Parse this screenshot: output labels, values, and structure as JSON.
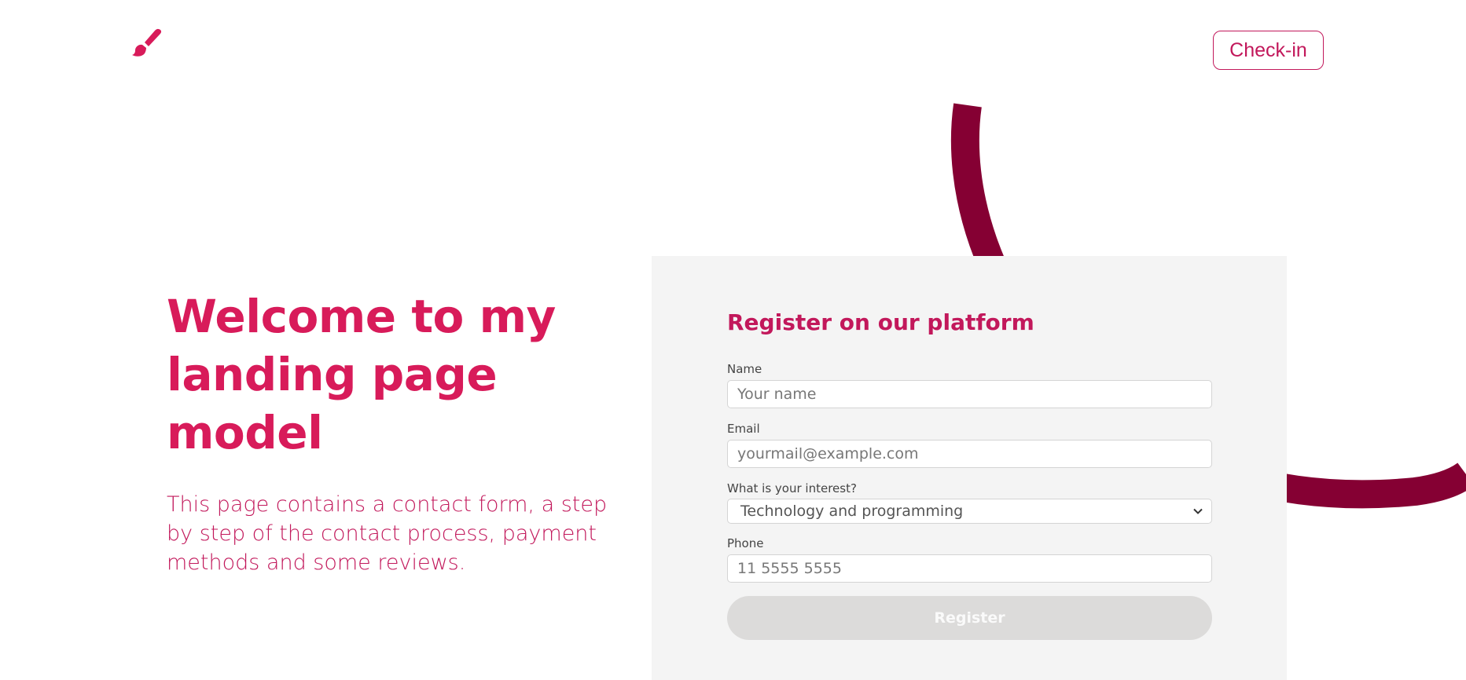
{
  "header": {
    "logo_icon": "paintbrush-icon",
    "checkin_label": "Check-in"
  },
  "hero": {
    "title": "Welcome to my landing page model",
    "description": "This page contains a contact form, a step by step of the contact process, payment methods and some reviews."
  },
  "form": {
    "title": "Register on our platform",
    "name": {
      "label": "Name",
      "placeholder": "Your name"
    },
    "email": {
      "label": "Email",
      "placeholder": "yourmail@example.com"
    },
    "interest": {
      "label": "What is your interest?",
      "selected": "Technology and programming"
    },
    "phone": {
      "label": "Phone",
      "placeholder": "11 5555 5555"
    },
    "submit_label": "Register"
  },
  "colors": {
    "brand": "#d81b5a",
    "brand_dark": "#c2185b",
    "arc": "#850033",
    "panel_bg": "#f4f4f4",
    "button_disabled": "#dcdbda"
  }
}
